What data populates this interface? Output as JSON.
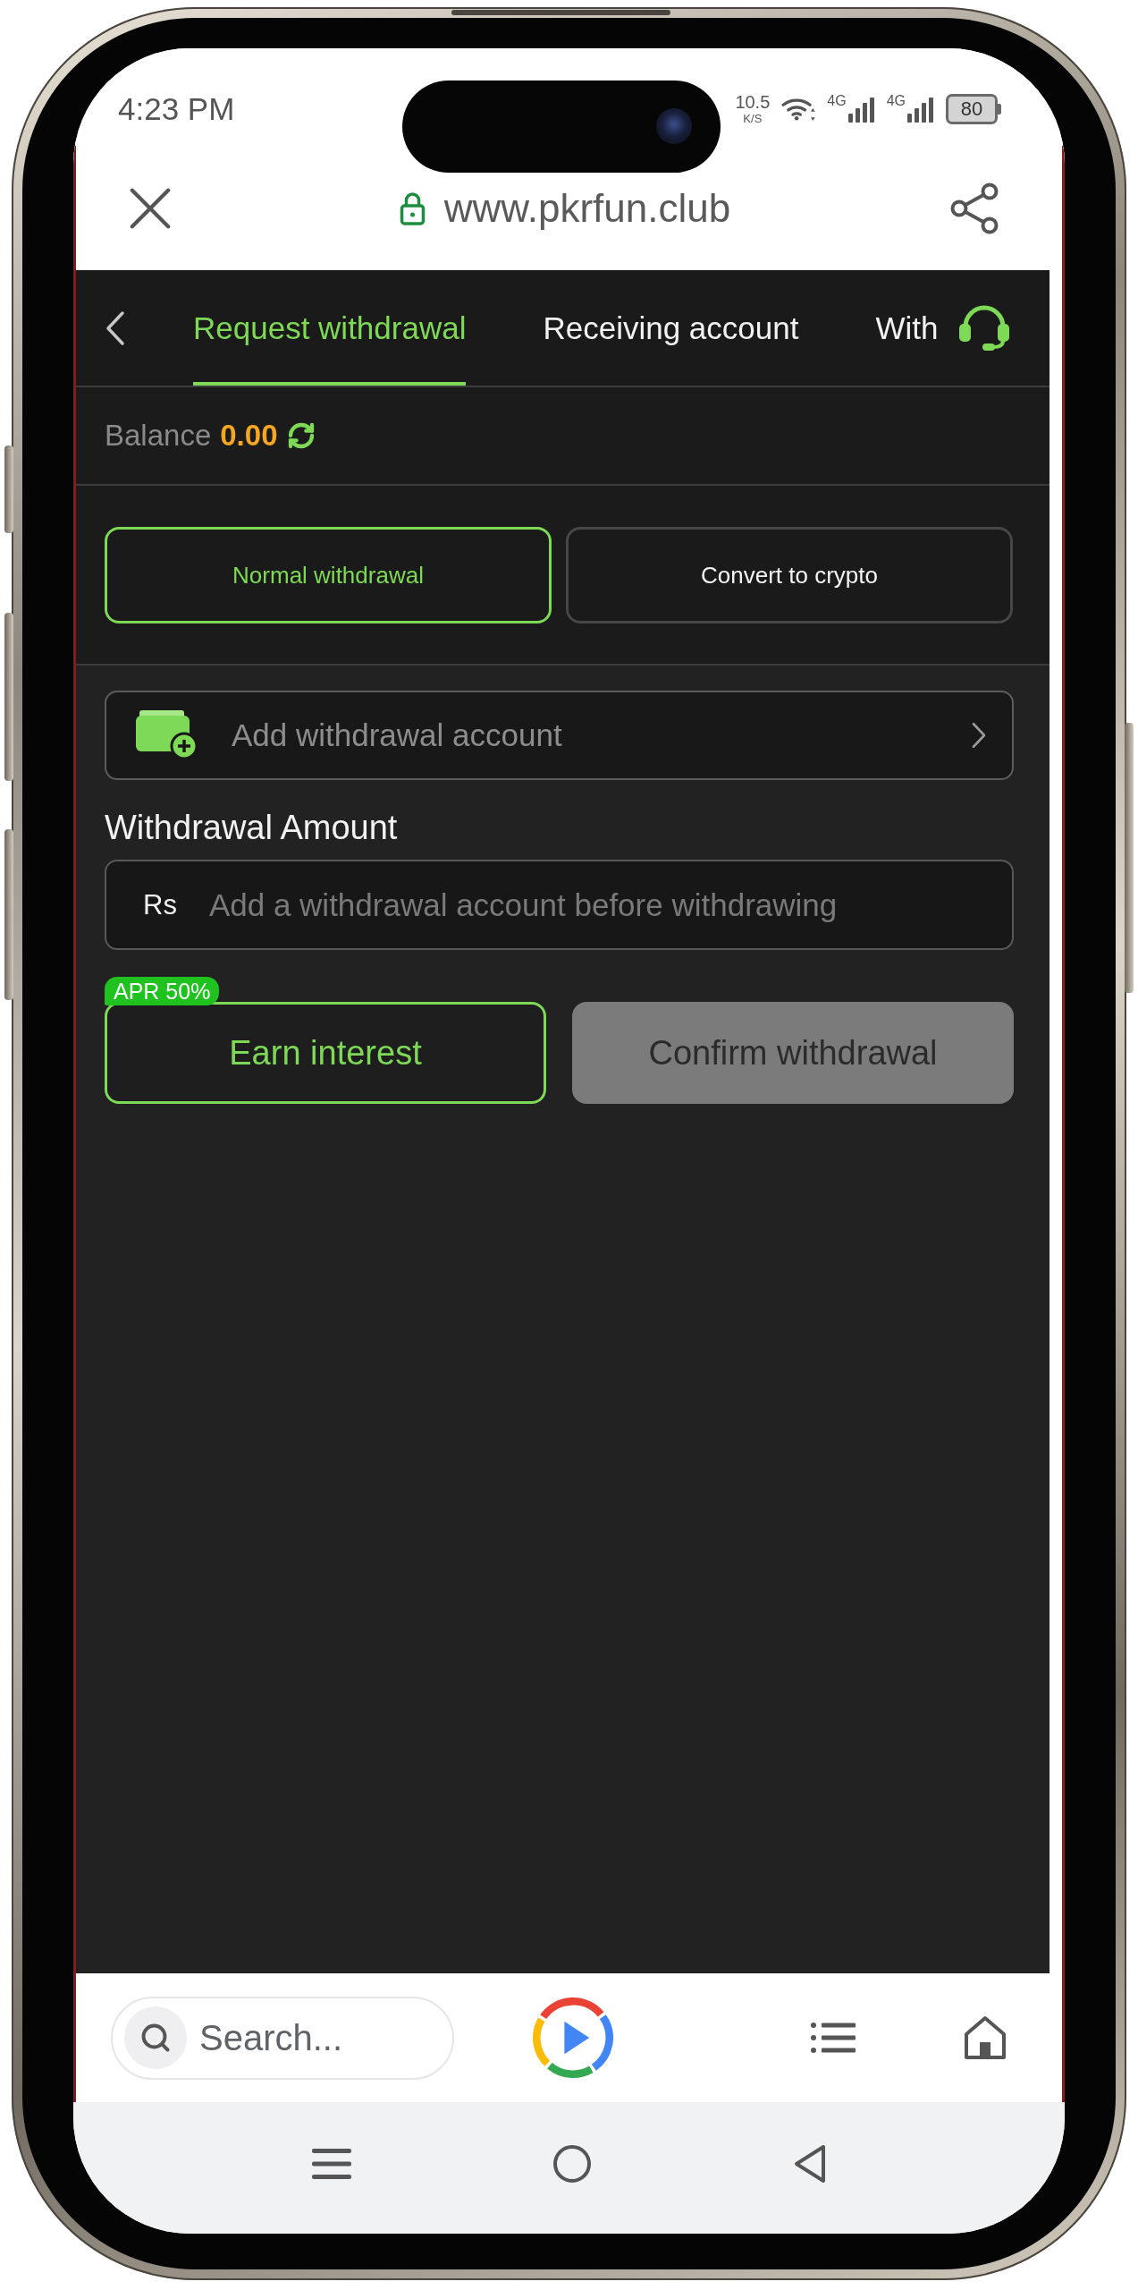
{
  "status_bar": {
    "time": "4:23 PM",
    "net_speed": "10.5",
    "net_speed_unit": "K/S",
    "signals": [
      {
        "label": "4G"
      },
      {
        "label": "4G"
      }
    ],
    "battery": "80"
  },
  "browser": {
    "url": "www.pkrfun.club",
    "secure": true
  },
  "tabs": [
    {
      "label": "Request withdrawal",
      "selected": true
    },
    {
      "label": "Receiving account",
      "selected": false
    },
    {
      "label": "With",
      "selected": false
    }
  ],
  "balance": {
    "label": "Balance",
    "amount": "0.00"
  },
  "withdrawal_modes": [
    {
      "label": "Normal withdrawal",
      "selected": true
    },
    {
      "label": "Convert to crypto",
      "selected": false
    }
  ],
  "account_row": {
    "label": "Add withdrawal account"
  },
  "amount": {
    "label": "Withdrawal Amount",
    "currency": "Rs",
    "placeholder": "Add a withdrawal account before withdrawing"
  },
  "actions": [
    {
      "kind": "outline",
      "label": "Earn interest",
      "badge": "APR 50%"
    },
    {
      "kind": "filled",
      "label": "Confirm withdrawal",
      "disabled": true
    }
  ],
  "bottom_bar": {
    "search": {
      "placeholder": "Search..."
    }
  }
}
